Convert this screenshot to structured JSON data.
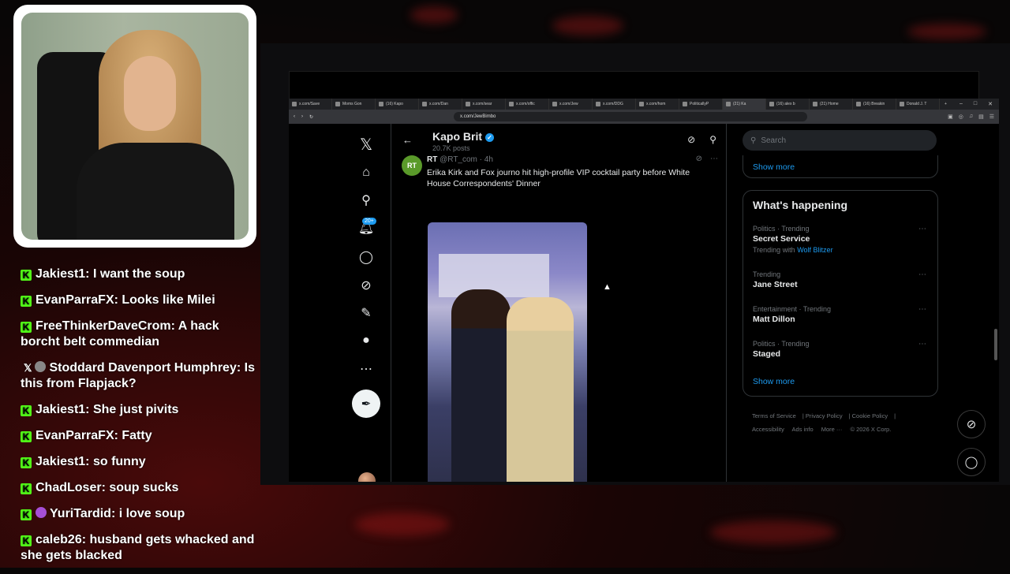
{
  "browser": {
    "tabs": [
      {
        "label": "x.com/Save"
      },
      {
        "label": "Moms Gon"
      },
      {
        "label": "(16) Kapo"
      },
      {
        "label": "x.com/Dan"
      },
      {
        "label": "x.com/sear"
      },
      {
        "label": "x.com/offic"
      },
      {
        "label": "x.com/Jew"
      },
      {
        "label": "x.com/DDG"
      },
      {
        "label": "x.com/hom"
      },
      {
        "label": "PoliticallyP"
      },
      {
        "label": "(21) Ka"
      },
      {
        "label": "(16) alex b"
      },
      {
        "label": "(21) Home"
      },
      {
        "label": "(16) Breakin"
      },
      {
        "label": "Donald J. T"
      }
    ],
    "url": "x.com/JewBimbo"
  },
  "profile": {
    "name": "Kapo Brit",
    "posts": "20.7K posts"
  },
  "tweet": {
    "avatar_text": "RT",
    "author": "RT",
    "handle": "@RT_com · 4h",
    "text": "Erika Kirk and Fox journo hit high-profile VIP cocktail party before White House Correspondents' Dinner"
  },
  "nav": {
    "notification_badge": "20+"
  },
  "sidebar": {
    "search_placeholder": "Search",
    "show_more_top": "Show more",
    "whats_happening": "What's happening",
    "trends": [
      {
        "category": "Politics · Trending",
        "name": "Secret Service",
        "with_prefix": "Trending with",
        "with": "Wolf Blitzer"
      },
      {
        "category": "Trending",
        "name": "Jane Street"
      },
      {
        "category": "Entertainment · Trending",
        "name": "Matt Dillon"
      },
      {
        "category": "Politics · Trending",
        "name": "Staged"
      }
    ],
    "show_more_bottom": "Show more",
    "footer": {
      "terms": "Terms of Service",
      "privacy": "Privacy Policy",
      "cookie": "Cookie Policy",
      "accessibility": "Accessibility",
      "ads": "Ads info",
      "more": "More ···",
      "copyright": "© 2026 X Corp."
    }
  },
  "chat": [
    {
      "user": "Jakiest1",
      "text": ": I want the soup",
      "badge": "kick"
    },
    {
      "user": "EvanParraFX",
      "text": ": Looks like Milei",
      "badge": "kick"
    },
    {
      "user": "FreeThinkerDaveCrom",
      "text": ": A hack borcht belt commedian",
      "badge": "kick"
    },
    {
      "user": "Stoddard Davenport Humphrey",
      "text": ": Is this from Flapjack?",
      "badge": "x"
    },
    {
      "user": "Jakiest1",
      "text": ": She just pivits",
      "badge": "kick"
    },
    {
      "user": "EvanParraFX",
      "text": ": Fatty",
      "badge": "kick"
    },
    {
      "user": "Jakiest1",
      "text": ": so funny",
      "badge": "kick"
    },
    {
      "user": "ChadLoser",
      "text": ": soup sucks",
      "badge": "kick"
    },
    {
      "user": "YuriTardid",
      "text": ": i love soup",
      "badge": "kick-avatar"
    },
    {
      "user": "caleb26",
      "text": ": husband gets whacked and she gets blacked",
      "badge": "kick"
    }
  ],
  "icons": {
    "x_logo": "x-logo-icon",
    "home": "home-icon",
    "search": "search-icon",
    "notifications": "bell-icon",
    "messages": "message-icon",
    "grok": "grok-icon",
    "lists": "list-icon",
    "profile": "person-icon",
    "more": "more-icon",
    "compose": "compose-icon"
  },
  "colors": {
    "accent": "#1d9bf0",
    "kick_green": "#53fc18"
  }
}
